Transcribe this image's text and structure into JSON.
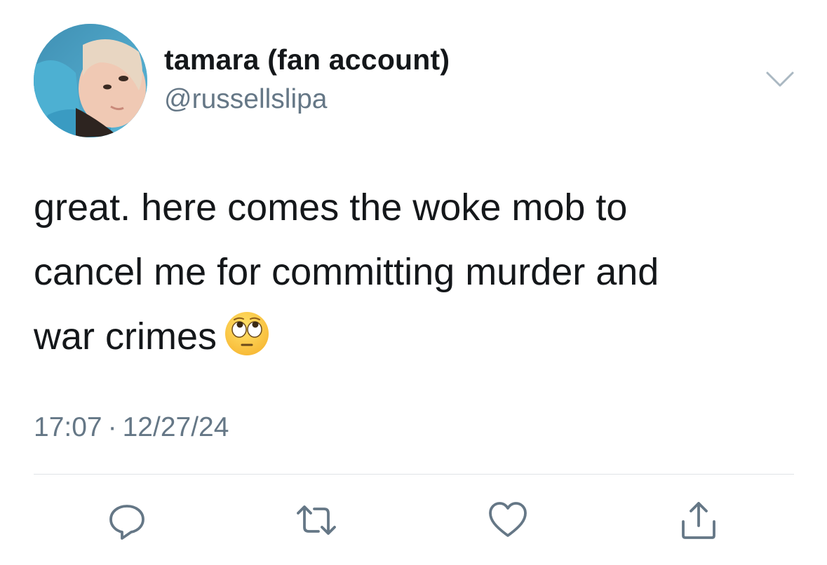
{
  "user": {
    "display_name": "tamara (fan account)",
    "handle": "@russellslipa",
    "avatar_icon": "profile-photo"
  },
  "tweet": {
    "lines": [
      "great. here comes the woke mob to",
      "cancel me for committing murder and",
      "war crimes"
    ],
    "emoji": "face-with-rolling-eyes",
    "time": "17:07",
    "separator": "·",
    "date": "12/27/24"
  },
  "actions": {
    "reply_icon": "reply-icon",
    "retweet_icon": "retweet-icon",
    "like_icon": "like-icon",
    "share_icon": "share-icon"
  },
  "colors": {
    "text": "#14171a",
    "secondary": "#657786",
    "icon": "#657786",
    "divider": "#dfe3e7"
  }
}
